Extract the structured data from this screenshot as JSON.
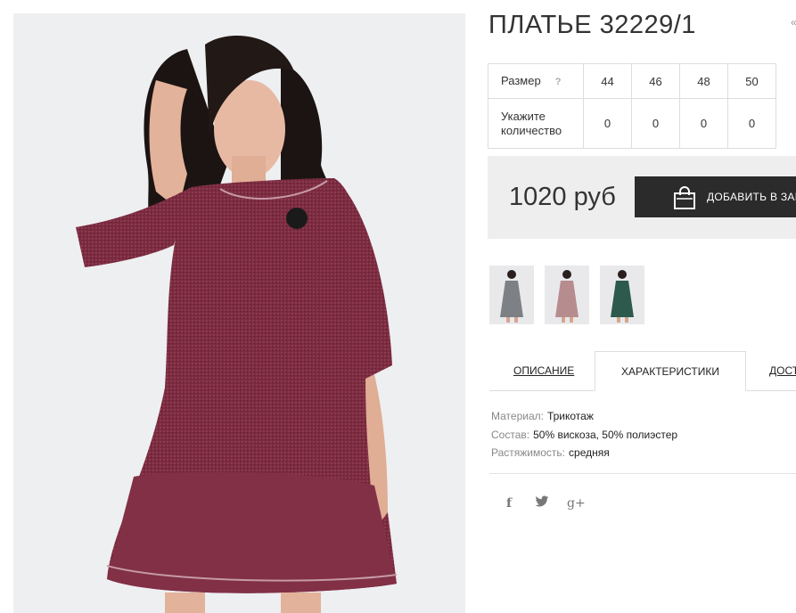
{
  "product": {
    "title": "ПЛАТЬЕ 32229/1",
    "title_extra": "«",
    "images": {
      "main": "burgundy dress photo",
      "thumbnails": [
        "grey dress",
        "pink dress",
        "green dress"
      ]
    }
  },
  "sizes": {
    "size_label": "Размер",
    "help_icon": "?",
    "values": [
      "44",
      "46",
      "48",
      "50"
    ],
    "qty_label": "Укажите количество",
    "quantities": [
      "0",
      "0",
      "0",
      "0"
    ]
  },
  "price": {
    "amount": "1020 руб",
    "add_to_cart": "ДОБАВИТЬ В ЗАКАЗ"
  },
  "tabs": [
    "ОПИСАНИЕ",
    "ХАРАКТЕРИСТИКИ",
    "ДОСТАВКА"
  ],
  "specs": [
    {
      "key": "Материал:",
      "value": "Трикотаж"
    },
    {
      "key": "Состав:",
      "value": "50% вискоза, 50% полиэстер"
    },
    {
      "key": "Растяжимость:",
      "value": "средняя"
    }
  ],
  "social": {
    "facebook": "f",
    "twitter": "twitter-icon",
    "google_plus": "g+"
  },
  "colors": {
    "dark_button": "#2b2b2b",
    "price_panel": "#eeeeee",
    "dress": "#7a2a3e"
  }
}
